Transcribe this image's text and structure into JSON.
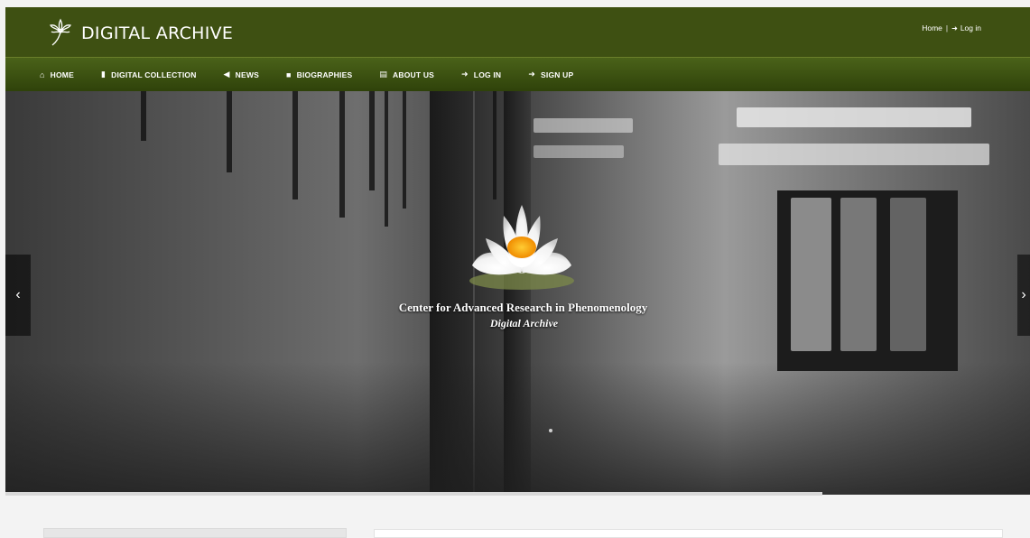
{
  "header": {
    "brand": "DIGITAL ARCHIVE",
    "top_links": {
      "home": "Home",
      "separator": "|",
      "login": "Log in"
    },
    "colors": {
      "header_bg": "#3e5012",
      "nav_bg": "#3a4f12"
    }
  },
  "nav": {
    "items": [
      {
        "label": "HOME",
        "icon": "home-icon",
        "glyph": "⌂"
      },
      {
        "label": "DIGITAL COLLECTION",
        "icon": "book-icon",
        "glyph": "▮"
      },
      {
        "label": "NEWS",
        "icon": "bullhorn-icon",
        "glyph": "◀"
      },
      {
        "label": "BIOGRAPHIES",
        "icon": "list-icon",
        "glyph": "■"
      },
      {
        "label": "ABOUT US",
        "icon": "document-icon",
        "glyph": "▤"
      },
      {
        "label": "LOG IN",
        "icon": "sign-in-icon",
        "glyph": "➜"
      },
      {
        "label": "SIGN UP",
        "icon": "sign-in-icon",
        "glyph": "➜"
      }
    ]
  },
  "hero": {
    "title": "Center for Advanced Research in Phenomenology",
    "subtitle": "Digital Archive",
    "prev_glyph": "‹",
    "next_glyph": "›",
    "image": "lotus-flower-over-hallway-lockers"
  }
}
